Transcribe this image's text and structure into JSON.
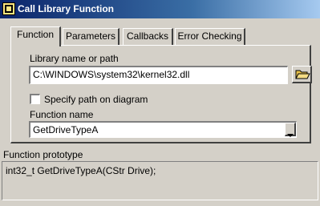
{
  "window": {
    "title": "Call Library Function"
  },
  "tabs": [
    {
      "label": "Function",
      "active": true
    },
    {
      "label": "Parameters",
      "active": false
    },
    {
      "label": "Callbacks",
      "active": false
    },
    {
      "label": "Error Checking",
      "active": false
    }
  ],
  "library": {
    "label": "Library name or path",
    "value": "C:\\WINDOWS\\system32\\kernel32.dll"
  },
  "specify_path": {
    "label": "Specify path on diagram",
    "checked": false
  },
  "function_name": {
    "label": "Function name",
    "value": "GetDriveTypeA"
  },
  "prototype": {
    "label": "Function prototype",
    "value": "int32_t GetDriveTypeA(CStr Drive);"
  },
  "icons": {
    "window": "labview-function-icon",
    "browse": "folder-open-icon",
    "dropdown": "dropdown-arrow-icon"
  },
  "colors": {
    "face": "#d4d0c8",
    "title_start": "#0a246a",
    "title_end": "#a6caf0",
    "folder": "#e8c24a"
  }
}
